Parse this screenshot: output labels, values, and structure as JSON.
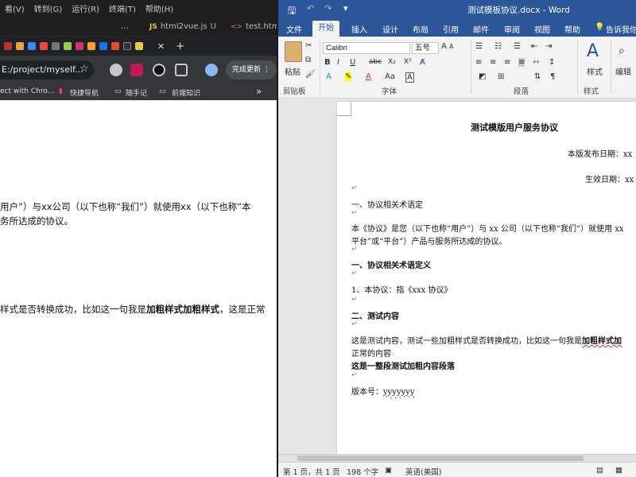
{
  "vscode": {
    "menu": [
      "看(V)",
      "转到(G)",
      "运行(R)",
      "终端(T)",
      "帮助(H)"
    ],
    "more": "...",
    "tabs": [
      {
        "icon": "JS",
        "label": "html2vue.js",
        "status": "U"
      },
      {
        "icon": "<>",
        "label": "test.html"
      }
    ]
  },
  "chrome": {
    "new_tab": "+",
    "url": "E:/project/myself...",
    "update_button": "完成更新",
    "bookmarks": [
      "ect with Chro...",
      "快捷导航",
      "随手记",
      "前端知识"
    ],
    "bookmarks_more": "»"
  },
  "left_page": {
    "line1": "用户”）与xx公司（以下也称“我们”）就使用xx（以下也称“本",
    "line2": "务所达成的协议。",
    "line3_normal": "样式是否转换成功，比如这一句我是",
    "line3_bold": "加粗样式加粗样式",
    "line3_tail": "，这是正常"
  },
  "word": {
    "title": "测试模板协议.docx  -  Word",
    "tabs": [
      "文件",
      "开始",
      "插入",
      "设计",
      "布局",
      "引用",
      "邮件",
      "审阅",
      "视图",
      "帮助",
      "告诉我你"
    ],
    "active_tab": "开始",
    "ribbon": {
      "paste": "粘贴",
      "font_name": "Calibri",
      "font_size": "五号",
      "style": "样式",
      "edit": "编辑",
      "groups": [
        "剪贴板",
        "字体",
        "段落",
        "样式"
      ],
      "font_buttons": [
        "B",
        "I",
        "U",
        "abc",
        "X₂",
        "X²"
      ],
      "aa": "Aa"
    },
    "doc": {
      "title": "测试模版用户服务协议",
      "release": "本版发布日期：xx",
      "effective": "生效日期：xx",
      "h1": "一、协议相关术语定",
      "p1a": "本《协议》是您（以下也称“用户”）与 xx 公司（以下也称“我们”）就使用 xx",
      "p1b": "平台”或“平台”）产品与服务所达成的协议。",
      "h2": "一、协议相关术语定义",
      "item1": "1、本协议：指《xxx 协议》",
      "h3": "二、测试内容",
      "p2a": "这是测试内容，测试一些加粗样式是否转换成功，比如这一句我是",
      "p2a_bold": "加粗样式加",
      "p2b": "正常的内容",
      "p3": "这是一整段测试加粗内容段落",
      "version_label": "版本号：",
      "version_value": "yyyyyyy"
    },
    "status": {
      "page": "第 1 页，共 1 页",
      "words": "198 个字",
      "lang": "英语(美国)"
    }
  },
  "colors": {
    "word_blue": "#2b579a",
    "chrome_dark": "#202124",
    "vscode_dark": "#1f1f1f"
  }
}
